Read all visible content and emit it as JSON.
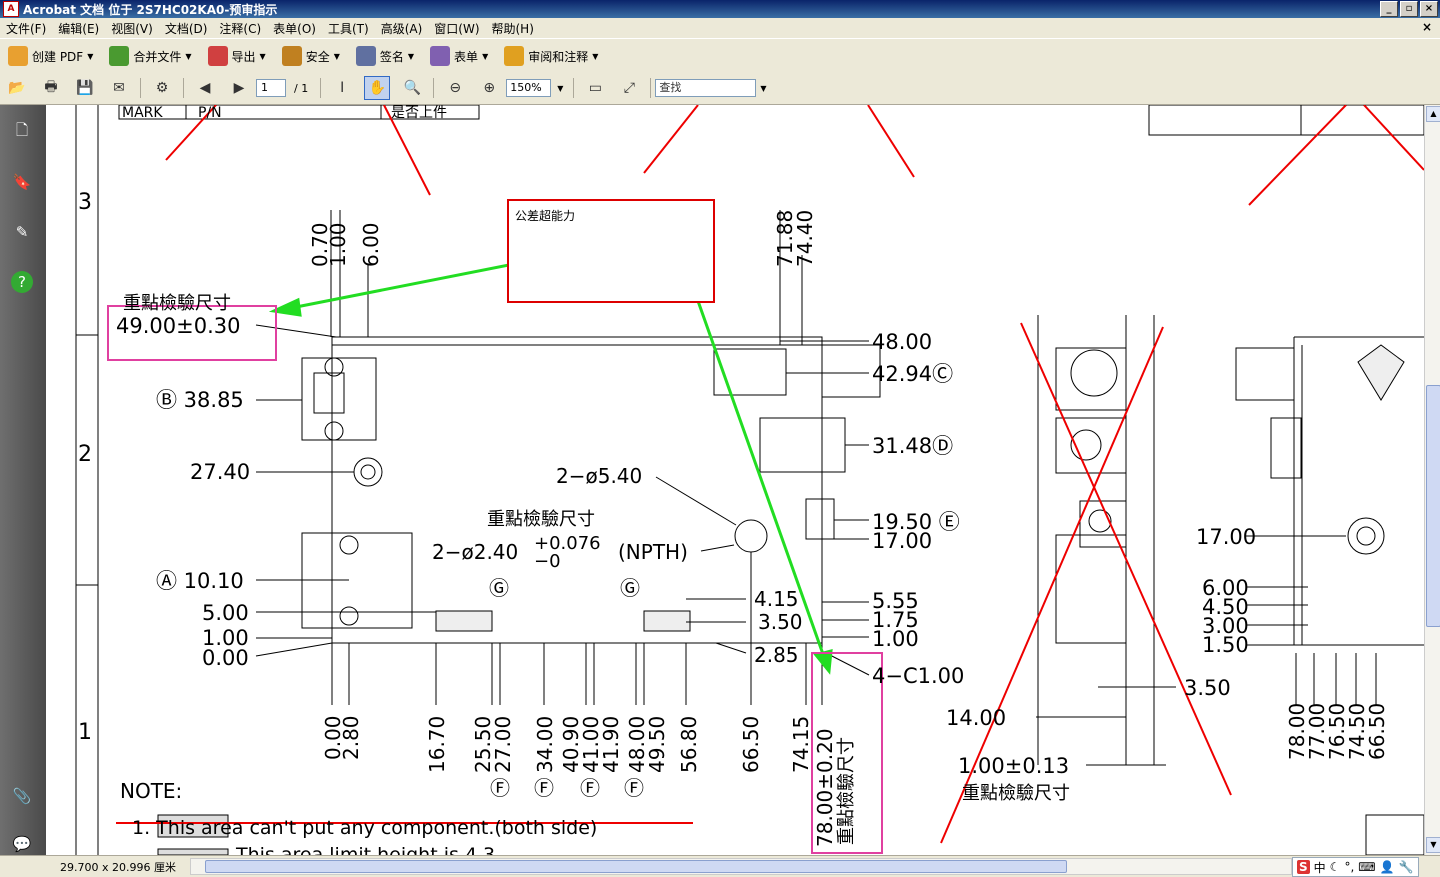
{
  "window": {
    "title": "Acrobat 文档 位于 2S7HC02KA0-预审指示",
    "controls": [
      "_",
      "▫",
      "×"
    ]
  },
  "menu": [
    "文件(F)",
    "编辑(E)",
    "视图(V)",
    "文档(D)",
    "注释(C)",
    "表单(O)",
    "工具(T)",
    "高级(A)",
    "窗口(W)",
    "帮助(H)"
  ],
  "menu_close": "×",
  "toolbar1": [
    {
      "label": "创建 PDF",
      "icon": "create-pdf-icon",
      "color": "#e8a030"
    },
    {
      "label": "合并文件",
      "icon": "combine-files-icon",
      "color": "#4a9a30"
    },
    {
      "label": "导出",
      "icon": "export-icon",
      "color": "#d04040"
    },
    {
      "label": "安全",
      "icon": "lock-icon",
      "color": "#c08020"
    },
    {
      "label": "签名",
      "icon": "pen-icon",
      "color": "#6070a0"
    },
    {
      "label": "表单",
      "icon": "form-icon",
      "color": "#8060b0"
    },
    {
      "label": "审阅和注释",
      "icon": "review-icon",
      "color": "#e0a020"
    }
  ],
  "toolbar2": {
    "page_current": "1",
    "page_total": "/ 1",
    "zoom": "150%",
    "find_placeholder": "查找"
  },
  "status": {
    "page_size": "29.700 x 20.996 厘米"
  },
  "ime": {
    "logo": "S",
    "lang": "中"
  },
  "annotation": {
    "comment_text": "公差超能力",
    "border_color": "#d00000",
    "arrow_color": "#22dd22",
    "highlight_color": "#e040a0"
  },
  "drawing": {
    "row_markers": [
      "3",
      "2",
      "1"
    ],
    "table_header_left": "MARK",
    "table_header_mid": "P/N",
    "table_header_right": "是否上件",
    "key_label": "重點檢驗尺寸",
    "dim_top": [
      "0.70",
      "1.00",
      "6.00"
    ],
    "dim_top_right": [
      "71.88",
      "74.40"
    ],
    "dim_main": "49.00±0.30",
    "dim_b": "Ⓑ 38.85",
    "dim_27": "27.40",
    "dim_a": "Ⓐ 10.10",
    "dim_5": "5.00",
    "dim_1": "1.00",
    "dim_0": "0.00",
    "hole_npth": "2−ø2.40",
    "hole_tol": "+0.076",
    "hole_tol2": "−0",
    "npth": "(NPTH)",
    "hole_540": "2−ø5.40",
    "g_mark": "Ⓖ",
    "right_dims": [
      "48.00",
      "42.94Ⓒ",
      "31.48Ⓓ",
      "19.50 Ⓔ",
      "17.00",
      "5.55",
      "1.75",
      "1.00"
    ],
    "mid_dims": [
      "4.15",
      "3.50",
      "2.85"
    ],
    "chamfer": "4−C1.00",
    "bottom_dims": [
      "0.00",
      "2.80",
      "16.70",
      "25.50",
      "27.00",
      "34.00",
      "40.90",
      "41.00",
      "41.90",
      "48.00",
      "49.50",
      "56.80",
      "66.50",
      "74.15"
    ],
    "bottom_key": "78.00±0.20",
    "f_marks": [
      "Ⓕ",
      "Ⓕ",
      "Ⓕ",
      "Ⓕ"
    ],
    "side_dims": [
      "14.00",
      "3.50",
      "1.00±0.13"
    ],
    "far_right_dims": [
      "17.00",
      "6.00",
      "4.50",
      "3.00",
      "1.50"
    ],
    "far_bottom_dims": [
      "78.00",
      "77.00",
      "76.50",
      "74.50",
      "66.50"
    ],
    "note_title": "NOTE:",
    "note_line": "1.        This area can't put any component.(both side)",
    "note_line2": "This area limit height is 4.3"
  }
}
